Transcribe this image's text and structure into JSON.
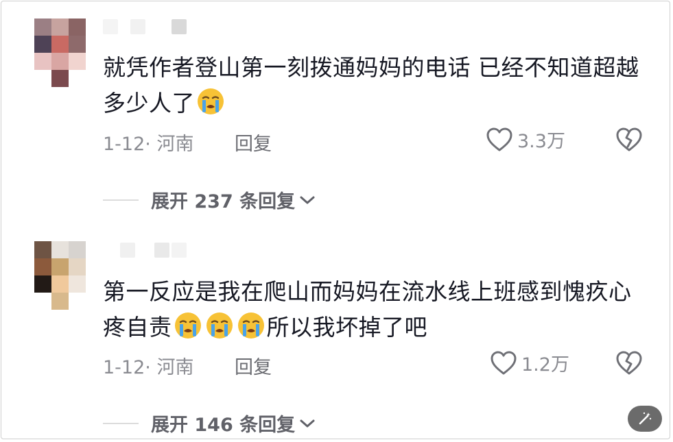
{
  "comments": [
    {
      "text_before": "就凭作者登山第一刻拨通妈妈的电话 已经不知道超越多少人了",
      "emoji_count": 1,
      "text_after": "",
      "emoji": "loudly-crying-face",
      "date": "1-12",
      "separator": "·",
      "location": "河南",
      "reply_label": "回复",
      "likes": "3.3万",
      "expand_label": "展开 237 条回复"
    },
    {
      "text_before": "第一反应是我在爬山而妈妈在流水线上班感到愧疚心疼自责",
      "emoji_count": 3,
      "text_after": "所以我坏掉了吧",
      "emoji": "loudly-crying-face",
      "date": "1-12",
      "separator": "·",
      "location": "河南",
      "reply_label": "回复",
      "likes": "1.2万",
      "expand_label": "展开 146 条回复"
    }
  ],
  "icons": {
    "like": "heart-outline-icon",
    "dislike": "broken-heart-icon",
    "expand": "chevron-down-icon",
    "fab": "magic-wand-icon"
  },
  "colors": {
    "text": "#161823",
    "meta": "#8a8b91",
    "emoji_face": "#f7c236",
    "tears": "#4aa3e8"
  }
}
